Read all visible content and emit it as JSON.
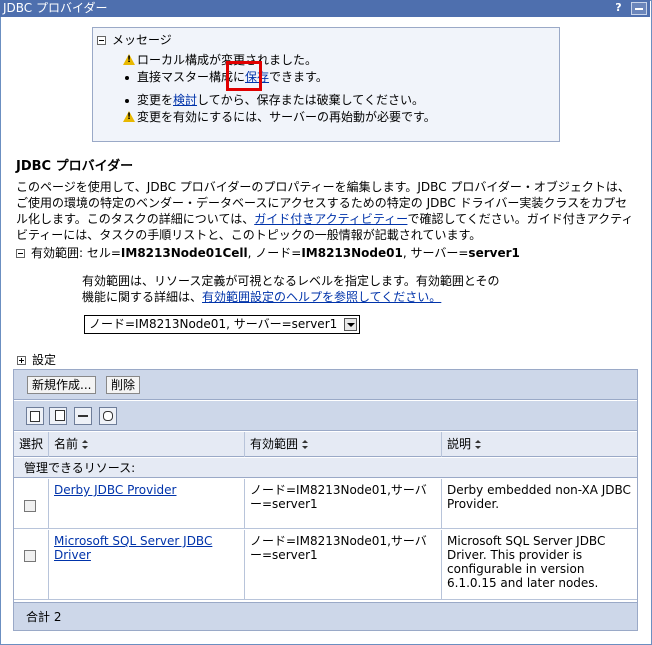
{
  "window": {
    "title": "JDBC プロバイダー",
    "help": "?"
  },
  "messages": {
    "header": "メッセージ",
    "line1": "ローカル構成が変更されました。",
    "line2_pre": "直接マスター構成に",
    "line2_link": "保存",
    "line2_post": "できます。",
    "line3_pre": "変更を",
    "line3_link": "検討",
    "line3_post": "してから、保存または破棄してください。",
    "line4": "変更を有効にするには、サーバーの再始動が必要です。"
  },
  "page": {
    "title": "JDBC プロバイダー",
    "desc_1": "このページを使用して、JDBC プロバイダーのプロパティーを編集します。JDBC プロバイダー・オブジェクトは、ご使用の環境の特定のベンダー・データベースにアクセスするための特定の JDBC ドライバー実装クラスをカプセル化します。このタスクの詳細については、",
    "desc_link": "ガイド付きアクティビティー",
    "desc_2": "で確認してください。ガイド付きアクティビティーには、タスクの手順リストと、このトピックの一般情報が記載されています。"
  },
  "scope": {
    "label": "有効範囲: セル=",
    "cell": "IM8213Node01Cell",
    "node_label": ", ノード=",
    "node": "IM8213Node01",
    "server_label": ", サーバー=",
    "server": "server1",
    "help_text": "有効範囲は、リソース定義が可視となるレベルを指定します。有効範囲とその機能に関する詳細は、",
    "help_link": "有効範囲設定のヘルプを参照してください。",
    "selected": "ノード=IM8213Node01, サーバー=server1"
  },
  "settings": {
    "label": "設定"
  },
  "toolbar": {
    "new_label": "新規作成...",
    "delete_label": "削除"
  },
  "table": {
    "headers": {
      "select": "選択",
      "name": "名前",
      "scope": "有効範囲",
      "desc": "説明"
    },
    "group": "管理できるリソース:",
    "rows": [
      {
        "name": "Derby JDBC Provider",
        "scope": "ノード=IM8213Node01,サーバー=server1",
        "desc": "Derby embedded non-XA JDBC Provider."
      },
      {
        "name": "Microsoft SQL Server JDBC Driver",
        "scope": "ノード=IM8213Node01,サーバー=server1",
        "desc": "Microsoft SQL Server JDBC Driver. This provider is configurable in version 6.1.0.15 and later nodes."
      }
    ],
    "total": "合計 2"
  }
}
